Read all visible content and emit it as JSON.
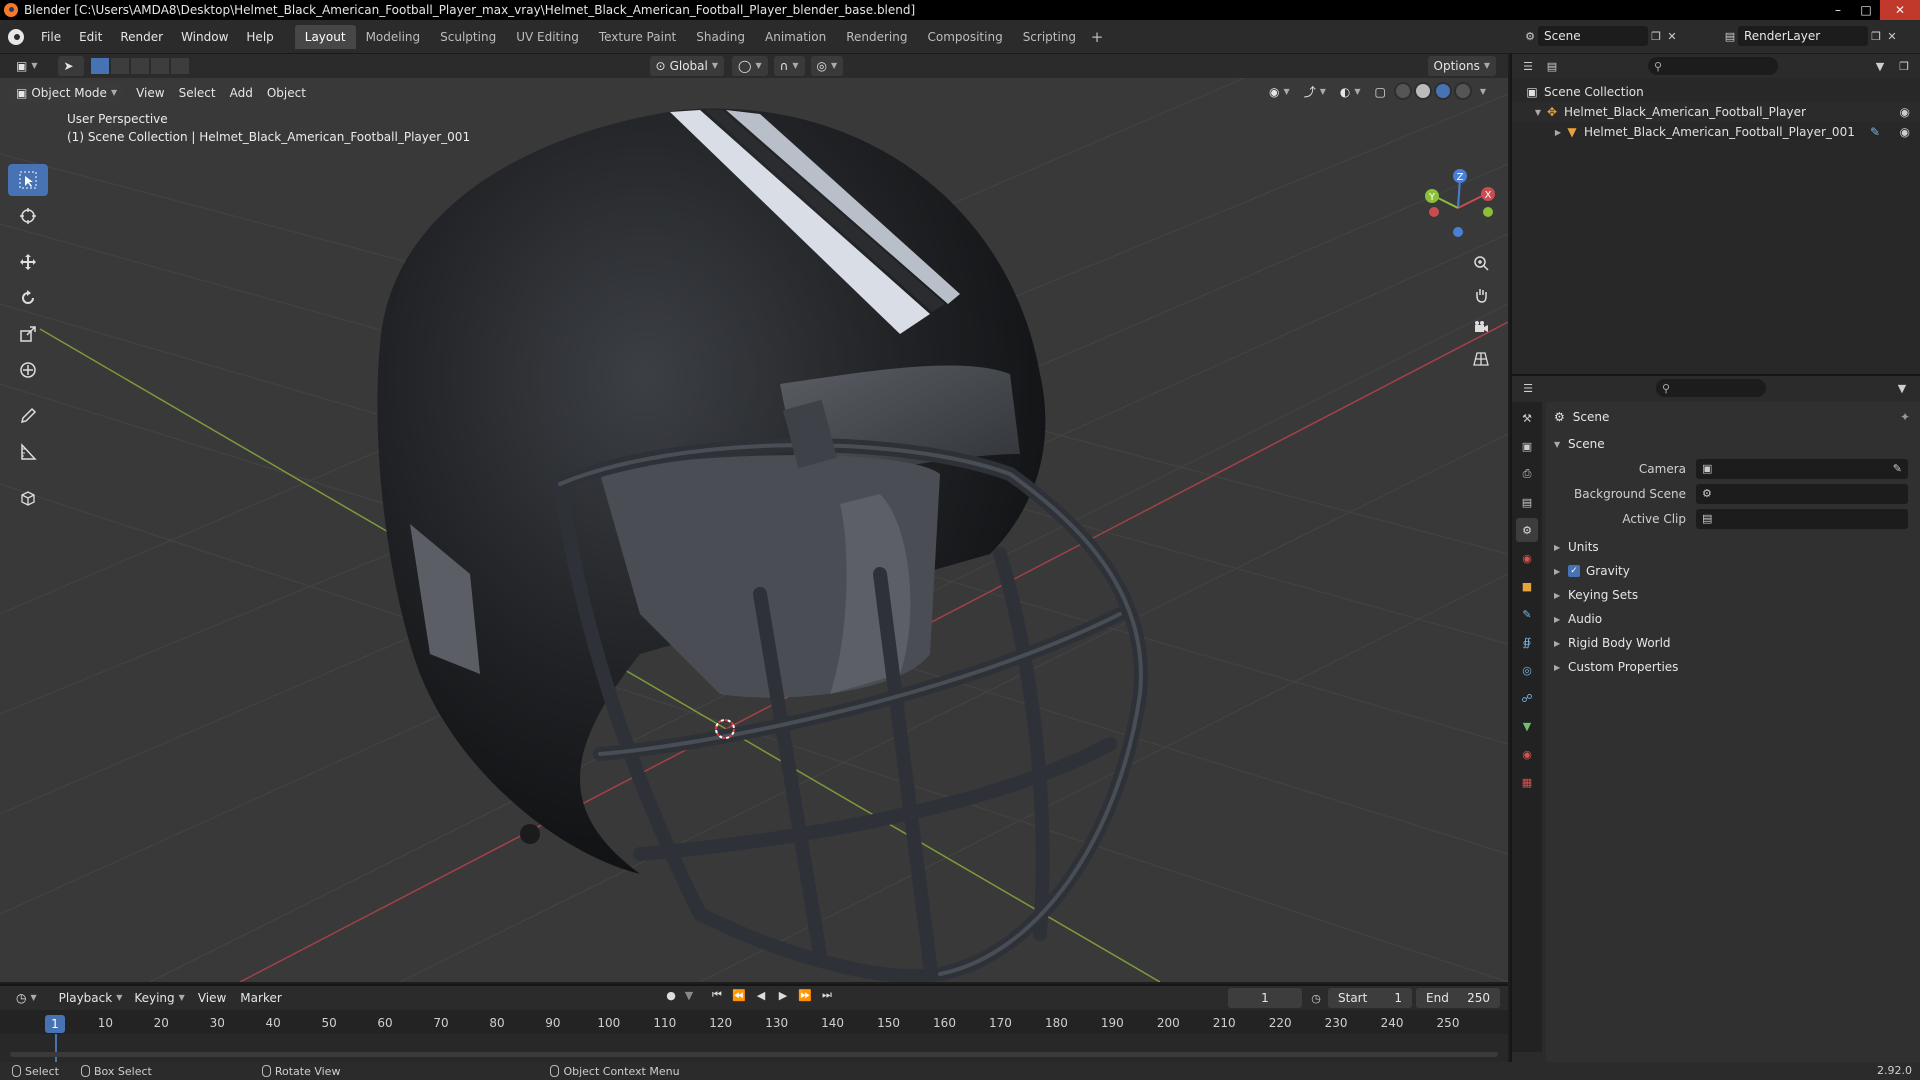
{
  "window": {
    "title": "Blender [C:\\Users\\AMDA8\\Desktop\\Helmet_Black_American_Football_Player_max_vray\\Helmet_Black_American_Football_Player_blender_base.blend]"
  },
  "menu": {
    "items": [
      "File",
      "Edit",
      "Render",
      "Window",
      "Help"
    ]
  },
  "workspaces": {
    "tabs": [
      "Layout",
      "Modeling",
      "Sculpting",
      "UV Editing",
      "Texture Paint",
      "Shading",
      "Animation",
      "Rendering",
      "Compositing",
      "Scripting"
    ],
    "active": "Layout",
    "add": "+"
  },
  "scene_selector": {
    "value": "Scene"
  },
  "renderlayer_selector": {
    "value": "RenderLayer"
  },
  "viewport": {
    "orientation": "Global",
    "options_label": "Options",
    "mode": "Object Mode",
    "menus": [
      "View",
      "Select",
      "Add",
      "Object"
    ],
    "info_line1": "User Perspective",
    "info_line2": "(1) Scene Collection | Helmet_Black_American_Football_Player_001"
  },
  "gizmo": {
    "x": "X",
    "y": "Y",
    "z": "Z"
  },
  "outliner": {
    "root": "Scene Collection",
    "items": [
      {
        "label": "Helmet_Black_American_Football_Player"
      },
      {
        "label": "Helmet_Black_American_Football_Player_001"
      }
    ]
  },
  "properties": {
    "context": "Scene",
    "panel_scene": "Scene",
    "rows": [
      {
        "label": "Camera"
      },
      {
        "label": "Background Scene"
      },
      {
        "label": "Active Clip"
      }
    ],
    "collapsed_panels": [
      "Units",
      "Gravity",
      "Keying Sets",
      "Audio",
      "Rigid Body World",
      "Custom Properties"
    ]
  },
  "timeline": {
    "menus": [
      "Playback",
      "Keying",
      "View",
      "Marker"
    ],
    "current_frame": "1",
    "start_label": "Start",
    "start": "1",
    "end_label": "End",
    "end": "250",
    "ticks": [
      "1",
      "10",
      "20",
      "30",
      "40",
      "50",
      "60",
      "70",
      "80",
      "90",
      "100",
      "110",
      "120",
      "130",
      "140",
      "150",
      "160",
      "170",
      "180",
      "190",
      "200",
      "210",
      "220",
      "230",
      "240",
      "250"
    ]
  },
  "statusbar": {
    "select": "Select",
    "box_select": "Box Select",
    "rotate_view": "Rotate View",
    "context_menu": "Object Context Menu",
    "version": "2.92.0"
  },
  "colors": {
    "accent": "#4772b3",
    "x_axis": "#c94c52",
    "y_axis": "#8bbf3a",
    "z_axis": "#4a7fd6"
  }
}
